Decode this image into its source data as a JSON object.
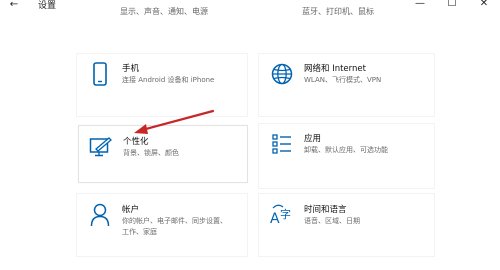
{
  "window": {
    "title": "设置",
    "back_glyph": "←",
    "minimize_glyph": "—",
    "maximize_glyph": "☐",
    "close_glyph": "✕"
  },
  "top_cut": {
    "left": "显示、声音、通知、电源",
    "right": "蓝牙、打印机、鼠标"
  },
  "items": [
    {
      "name": "手机",
      "desc": [
        "连接 Android 设备和 iPhone"
      ],
      "icon": "phone-icon"
    },
    {
      "name": "网络和 Internet",
      "desc": [
        "WLAN、飞行模式、VPN"
      ],
      "icon": "globe-icon"
    },
    {
      "name": "个性化",
      "desc": [
        "背景、锁屏、颜色"
      ],
      "icon": "personalization-icon"
    },
    {
      "name": "应用",
      "desc": [
        "卸载、默认应用、可选功能"
      ],
      "icon": "apps-list-icon"
    },
    {
      "name": "帐户",
      "desc": [
        "你的帐户、电子邮件、同步设置、",
        "工作、家庭"
      ],
      "icon": "account-icon"
    },
    {
      "name": "时间和语言",
      "desc": [
        "语音、区域、日期"
      ],
      "icon": "time-language-icon"
    }
  ],
  "accent_color": "#0063b1",
  "arrow_color": "#c62828"
}
